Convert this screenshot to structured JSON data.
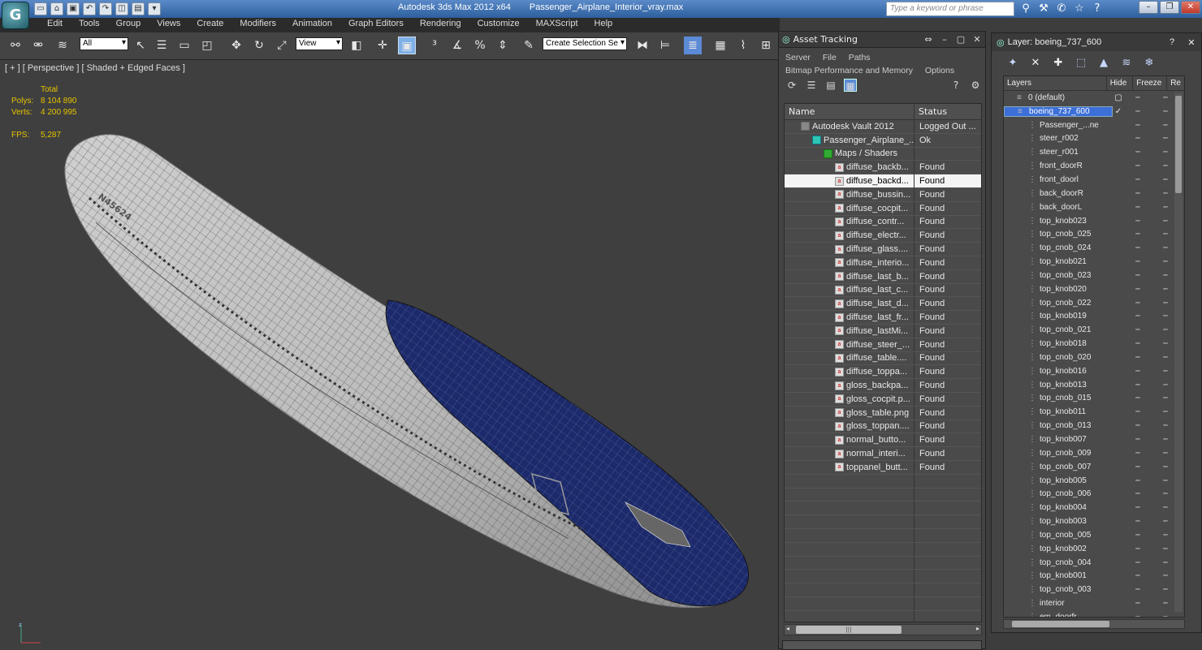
{
  "app": {
    "title": "Autodesk 3ds Max  2012 x64",
    "file": "Passenger_Airplane_Interior_vray.max",
    "search_placeholder": "Type a keyword or phrase"
  },
  "menu": [
    "Edit",
    "Tools",
    "Group",
    "Views",
    "Create",
    "Modifiers",
    "Animation",
    "Graph Editors",
    "Rendering",
    "Customize",
    "MAXScript",
    "Help"
  ],
  "toolbar": {
    "selection_filter": "All",
    "reference_coord": "View",
    "named_selection": "Create Selection Se"
  },
  "viewport": {
    "label": "[ + ] [ Perspective ] [ Shaded + Edged Faces ]",
    "stats_header": "Total",
    "polys_label": "Polys:",
    "polys": "8 104 890",
    "verts_label": "Verts:",
    "verts": "4 200 995",
    "fps_label": "FPS:",
    "fps": "5,287",
    "fuselage_reg": "N45624"
  },
  "asset_tracking": {
    "title": "Asset Tracking",
    "menu1": [
      "Server",
      "File",
      "Paths"
    ],
    "menu2": [
      "Bitmap Performance and Memory",
      "Options"
    ],
    "columns": [
      "Name",
      "Status"
    ],
    "rows": [
      {
        "name": "Autodesk Vault 2012",
        "status": "Logged Out ...",
        "indent": 1,
        "icon": "vault"
      },
      {
        "name": "Passenger_Airplane_...",
        "status": "Ok",
        "indent": 2,
        "icon": "max"
      },
      {
        "name": "Maps / Shaders",
        "status": "",
        "indent": 3,
        "icon": "folder"
      },
      {
        "name": "diffuse_backb...",
        "status": "Found",
        "indent": 4,
        "icon": "bitmap"
      },
      {
        "name": "diffuse_backd...",
        "status": "Found",
        "indent": 4,
        "icon": "bitmap",
        "selected": true
      },
      {
        "name": "diffuse_bussin...",
        "status": "Found",
        "indent": 4,
        "icon": "bitmap"
      },
      {
        "name": "diffuse_cocpit...",
        "status": "Found",
        "indent": 4,
        "icon": "bitmap"
      },
      {
        "name": "diffuse_contr...",
        "status": "Found",
        "indent": 4,
        "icon": "bitmap"
      },
      {
        "name": "diffuse_electr...",
        "status": "Found",
        "indent": 4,
        "icon": "bitmap"
      },
      {
        "name": "diffuse_glass....",
        "status": "Found",
        "indent": 4,
        "icon": "bitmap"
      },
      {
        "name": "diffuse_interio...",
        "status": "Found",
        "indent": 4,
        "icon": "bitmap"
      },
      {
        "name": "diffuse_last_b...",
        "status": "Found",
        "indent": 4,
        "icon": "bitmap"
      },
      {
        "name": "diffuse_last_c...",
        "status": "Found",
        "indent": 4,
        "icon": "bitmap"
      },
      {
        "name": "diffuse_last_d...",
        "status": "Found",
        "indent": 4,
        "icon": "bitmap"
      },
      {
        "name": "diffuse_last_fr...",
        "status": "Found",
        "indent": 4,
        "icon": "bitmap"
      },
      {
        "name": "diffuse_lastMi...",
        "status": "Found",
        "indent": 4,
        "icon": "bitmap"
      },
      {
        "name": "diffuse_steer_...",
        "status": "Found",
        "indent": 4,
        "icon": "bitmap"
      },
      {
        "name": "diffuse_table....",
        "status": "Found",
        "indent": 4,
        "icon": "bitmap"
      },
      {
        "name": "diffuse_toppa...",
        "status": "Found",
        "indent": 4,
        "icon": "bitmap"
      },
      {
        "name": "gloss_backpa...",
        "status": "Found",
        "indent": 4,
        "icon": "bitmap"
      },
      {
        "name": "gloss_cocpit.p...",
        "status": "Found",
        "indent": 4,
        "icon": "bitmap"
      },
      {
        "name": "gloss_table.png",
        "status": "Found",
        "indent": 4,
        "icon": "bitmap"
      },
      {
        "name": "gloss_toppan....",
        "status": "Found",
        "indent": 4,
        "icon": "bitmap"
      },
      {
        "name": "normal_butto...",
        "status": "Found",
        "indent": 4,
        "icon": "bitmap"
      },
      {
        "name": "normal_interi...",
        "status": "Found",
        "indent": 4,
        "icon": "bitmap"
      },
      {
        "name": "toppanel_butt...",
        "status": "Found",
        "indent": 4,
        "icon": "bitmap"
      }
    ]
  },
  "layers": {
    "title": "Layer: boeing_737_600",
    "columns": [
      "Layers",
      "Hide",
      "Freeze",
      "Re"
    ],
    "items": [
      {
        "name": "0 (default)",
        "top": true
      },
      {
        "name": "boeing_737_600",
        "top": true,
        "selected": true
      },
      {
        "name": "Passenger_...ne"
      },
      {
        "name": "steer_r002"
      },
      {
        "name": "steer_r001"
      },
      {
        "name": "front_doorR"
      },
      {
        "name": "front_doorl"
      },
      {
        "name": "back_doorR"
      },
      {
        "name": "back_doorL"
      },
      {
        "name": "top_knob023"
      },
      {
        "name": "top_cnob_025"
      },
      {
        "name": "top_cnob_024"
      },
      {
        "name": "top_knob021"
      },
      {
        "name": "top_cnob_023"
      },
      {
        "name": "top_knob020"
      },
      {
        "name": "top_cnob_022"
      },
      {
        "name": "top_knob019"
      },
      {
        "name": "top_cnob_021"
      },
      {
        "name": "top_knob018"
      },
      {
        "name": "top_cnob_020"
      },
      {
        "name": "top_knob016"
      },
      {
        "name": "top_knob013"
      },
      {
        "name": "top_cnob_015"
      },
      {
        "name": "top_knob011"
      },
      {
        "name": "top_cnob_013"
      },
      {
        "name": "top_knob007"
      },
      {
        "name": "top_cnob_009"
      },
      {
        "name": "top_cnob_007"
      },
      {
        "name": "top_knob005"
      },
      {
        "name": "top_cnob_006"
      },
      {
        "name": "top_knob004"
      },
      {
        "name": "top_knob003"
      },
      {
        "name": "top_cnob_005"
      },
      {
        "name": "top_knob002"
      },
      {
        "name": "top_cnob_004"
      },
      {
        "name": "top_knob001"
      },
      {
        "name": "top_cnob_003"
      },
      {
        "name": "interior"
      },
      {
        "name": "em_doorfr"
      }
    ]
  },
  "colors": {
    "selection": "#3c6fd8",
    "stats": "#e6c300",
    "fuselage_blue": "#1c2a6b"
  }
}
